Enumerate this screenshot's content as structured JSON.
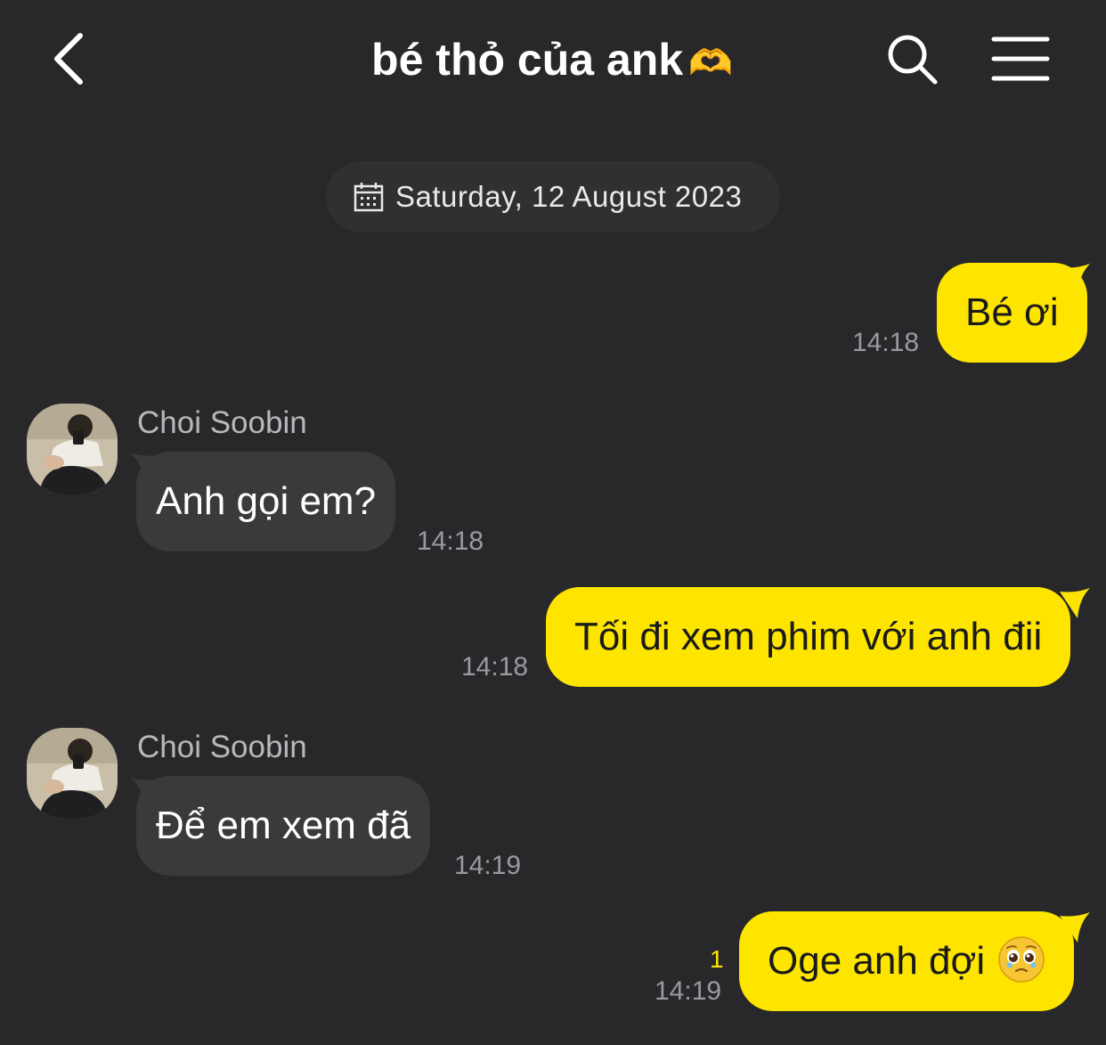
{
  "header": {
    "title": "bé thỏ của ank",
    "title_emoji": "🫶",
    "back_icon": "chevron-left-icon",
    "search_icon": "search-icon",
    "menu_icon": "hamburger-menu-icon"
  },
  "date_divider": {
    "icon": "calendar-icon",
    "text": "Saturday, 12 August 2023"
  },
  "messages": [
    {
      "direction": "out",
      "text": "Bé ơi",
      "time": "14:18"
    },
    {
      "direction": "in",
      "sender": "Choi Soobin",
      "text": "Anh gọi em?",
      "time": "14:18"
    },
    {
      "direction": "out",
      "text": "Tối đi xem phim với anh đii",
      "time": "14:18"
    },
    {
      "direction": "in",
      "sender": "Choi Soobin",
      "text": "Để em xem đã",
      "time": "14:19"
    },
    {
      "direction": "out",
      "text": "Oge anh đợi",
      "emoji": "🥹",
      "time": "14:19",
      "unread_count": "1"
    }
  ],
  "colors": {
    "background": "#28282b",
    "outgoing_bubble": "#fde500",
    "incoming_bubble": "#3a3a3c",
    "timestamp": "#9a9a9e",
    "unread": "#fde500"
  }
}
